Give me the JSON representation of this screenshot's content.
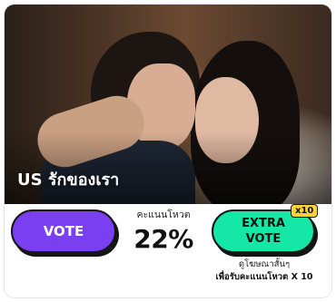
{
  "card": {
    "title": "US รักของเรา"
  },
  "vote": {
    "button_label": "VOTE"
  },
  "score": {
    "label": "คะแนนโหวต",
    "value": "22%"
  },
  "extra_vote": {
    "line1": "EXTRA",
    "line2": "VOTE",
    "badge": "x10",
    "caption_line1": "ดูโฆษณาสั้นๆ",
    "caption_line2": "เพื่อรับคะแนนโหวต X 10"
  },
  "colors": {
    "vote_button": "#7b3ff2",
    "extra_button": "#15e7a6",
    "badge": "#ffd23a"
  }
}
